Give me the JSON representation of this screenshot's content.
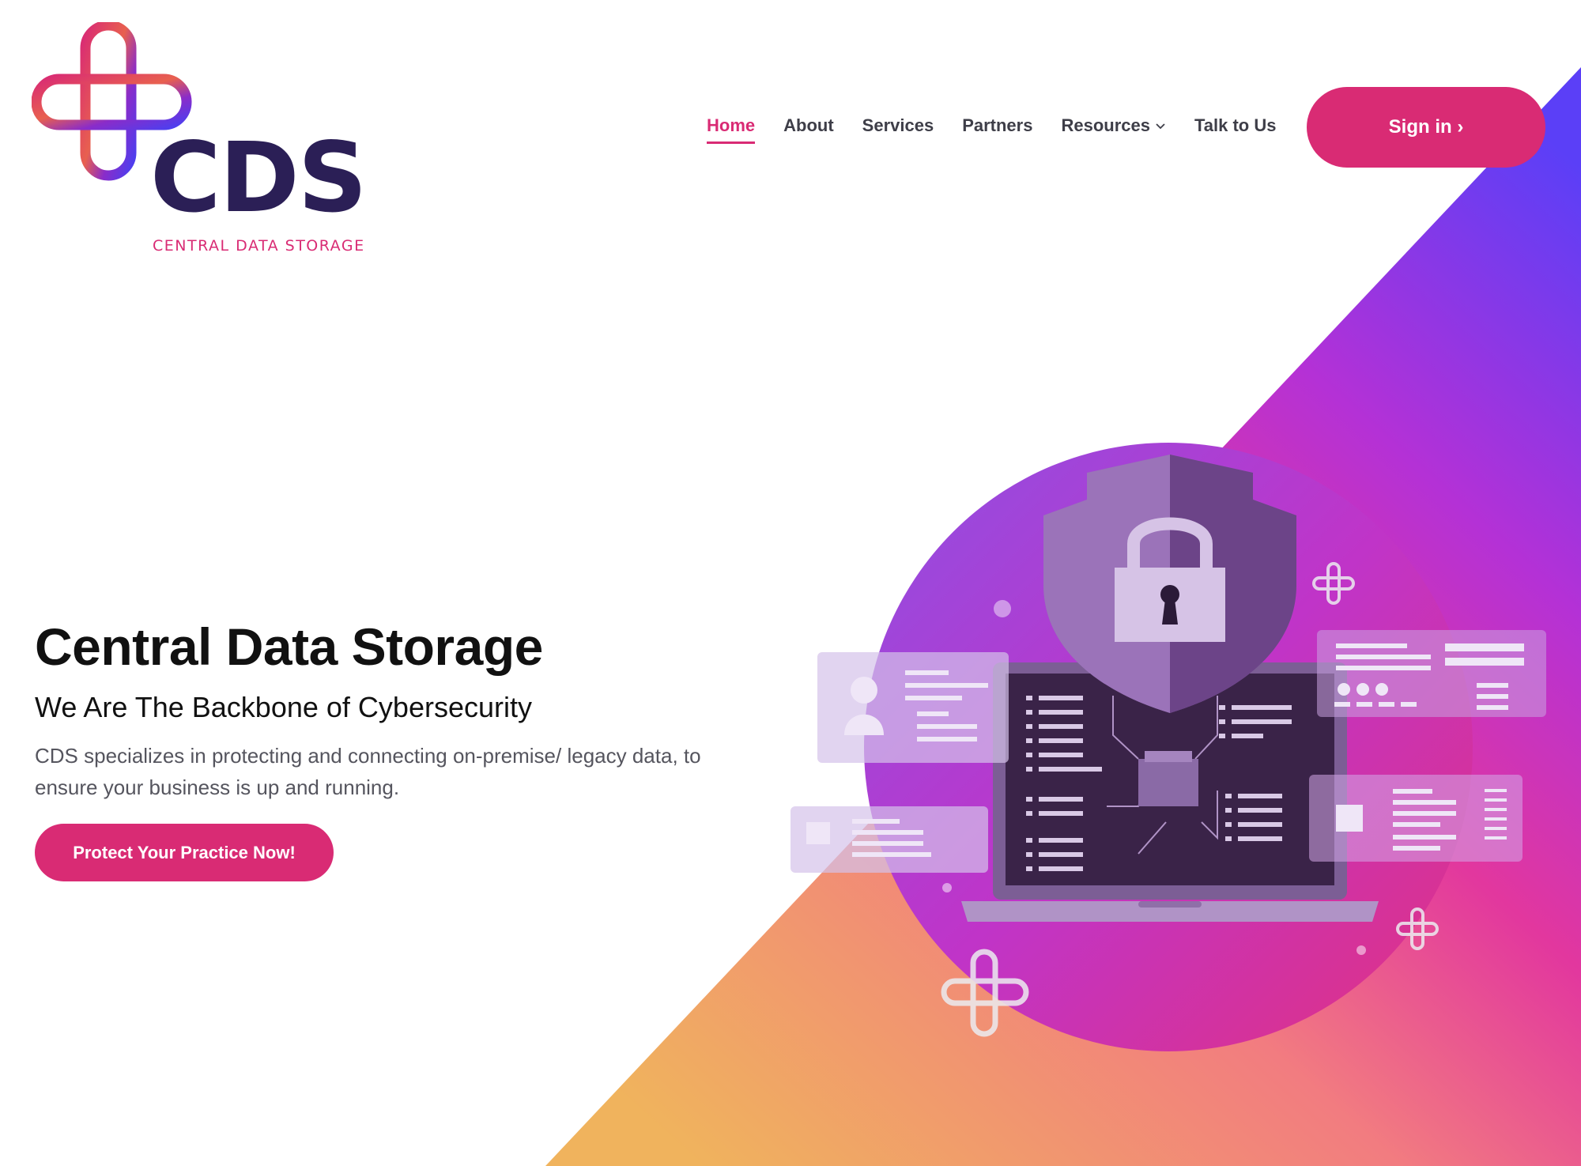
{
  "logo": {
    "letters": "CDS",
    "tagline": "CENTRAL DATA STORAGE"
  },
  "nav": {
    "items": [
      {
        "label": "Home",
        "active": true
      },
      {
        "label": "About"
      },
      {
        "label": "Services"
      },
      {
        "label": "Partners"
      },
      {
        "label": "Resources",
        "has_dropdown": true
      },
      {
        "label": "Talk to Us"
      }
    ],
    "signin_label": "Sign in ›"
  },
  "hero": {
    "title": "Central Data Storage",
    "subtitle": "We Are The Backbone of Cybersecurity",
    "description": "CDS specializes in protecting and connecting on-premise/ legacy data, to ensure your business is up and running.",
    "cta_label": "Protect Your Practice Now!"
  },
  "colors": {
    "brand_pink": "#d92b74",
    "brand_navy": "#2b1f56",
    "gradient_orange": "#f0b35d",
    "gradient_magenta": "#e2379e",
    "gradient_purple": "#5b3ff7"
  },
  "icons": [
    "chevron-down-icon",
    "shield-icon",
    "padlock-icon",
    "laptop-icon",
    "plus-cross-icon",
    "user-card-icon"
  ]
}
